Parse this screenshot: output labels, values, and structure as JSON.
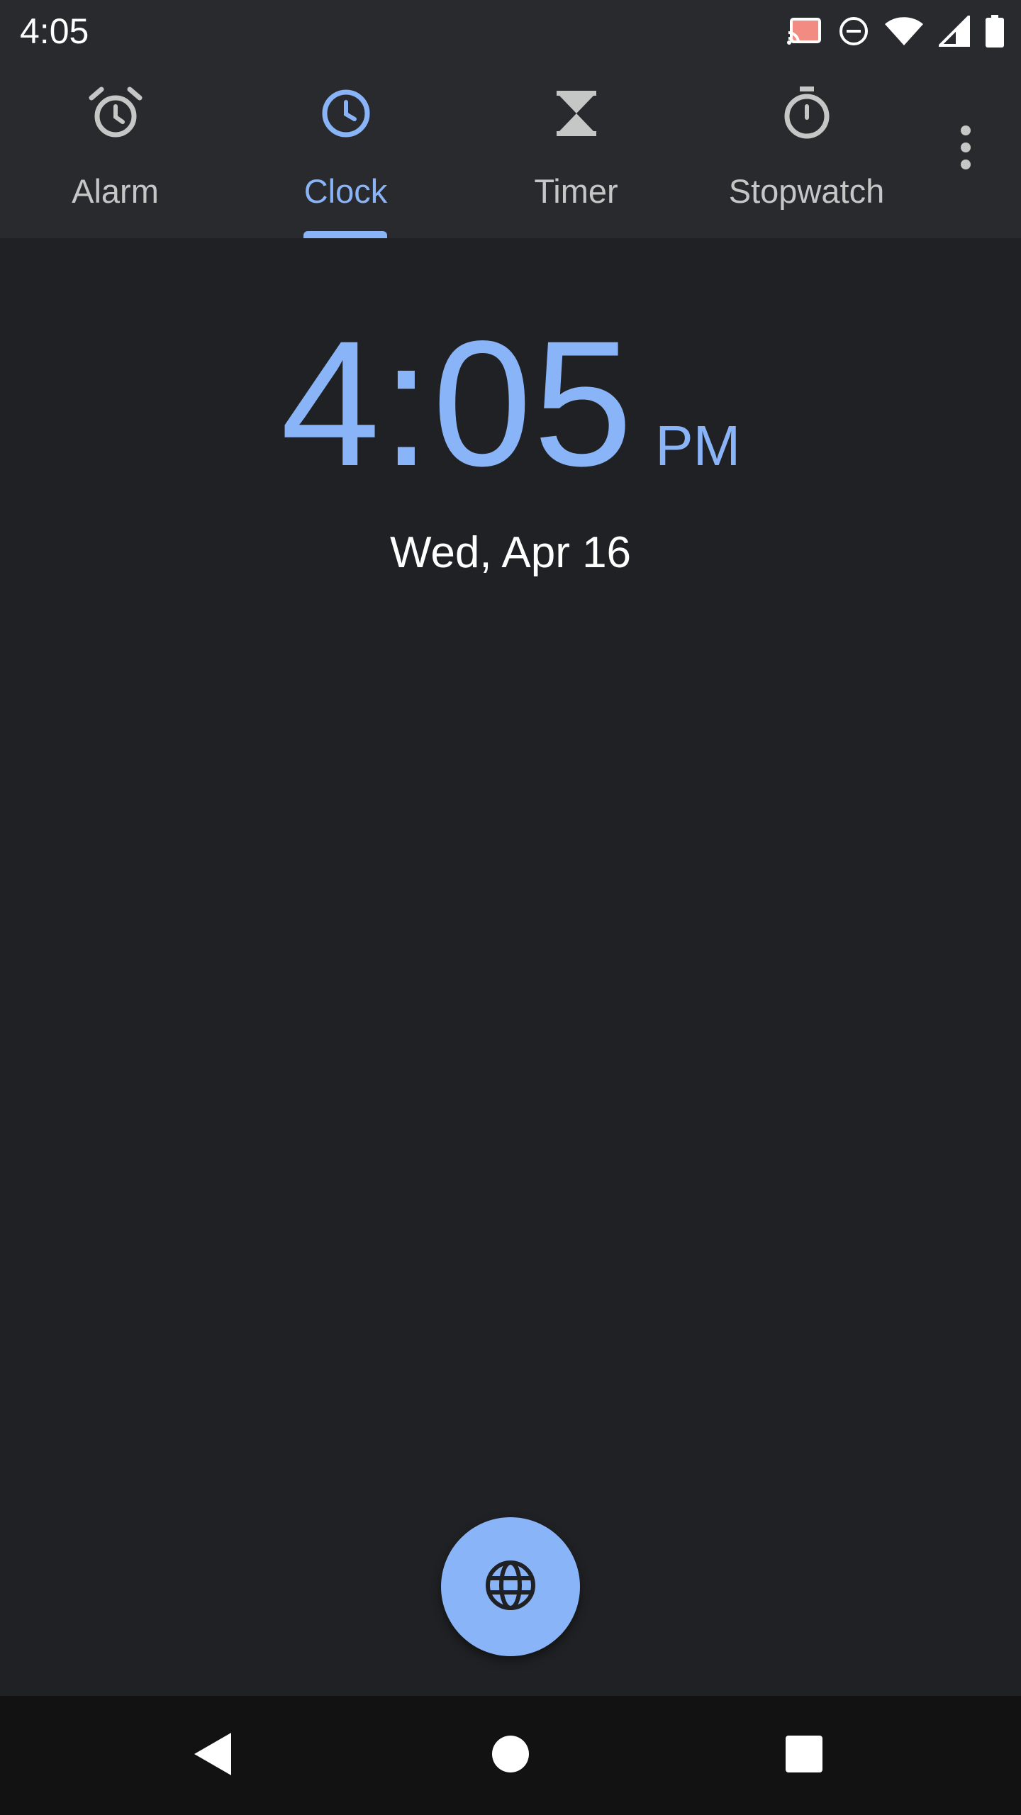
{
  "status_bar": {
    "time": "4:05",
    "icons": [
      "cast-icon",
      "do-not-disturb-icon",
      "wifi-icon",
      "cellular-signal-icon",
      "battery-icon"
    ]
  },
  "tabs": [
    {
      "label": "Alarm",
      "icon": "alarm-icon",
      "active": false
    },
    {
      "label": "Clock",
      "icon": "clock-icon",
      "active": true
    },
    {
      "label": "Timer",
      "icon": "hourglass-icon",
      "active": false
    },
    {
      "label": "Stopwatch",
      "icon": "stopwatch-icon",
      "active": false
    }
  ],
  "overflow_menu": {
    "icon": "more-vert-icon"
  },
  "clock": {
    "time": "4:05",
    "ampm": "PM",
    "date": "Wed, Apr 16"
  },
  "fab": {
    "icon": "globe-icon"
  },
  "nav_bar": {
    "back": "back-icon",
    "home": "home-icon",
    "recents": "recents-icon"
  },
  "colors": {
    "accent": "#8ab4f8",
    "background": "#202124",
    "toolbar": "#292a2d",
    "inactive_tab": "#c4c7c5",
    "cast_accent": "#f28b82"
  }
}
